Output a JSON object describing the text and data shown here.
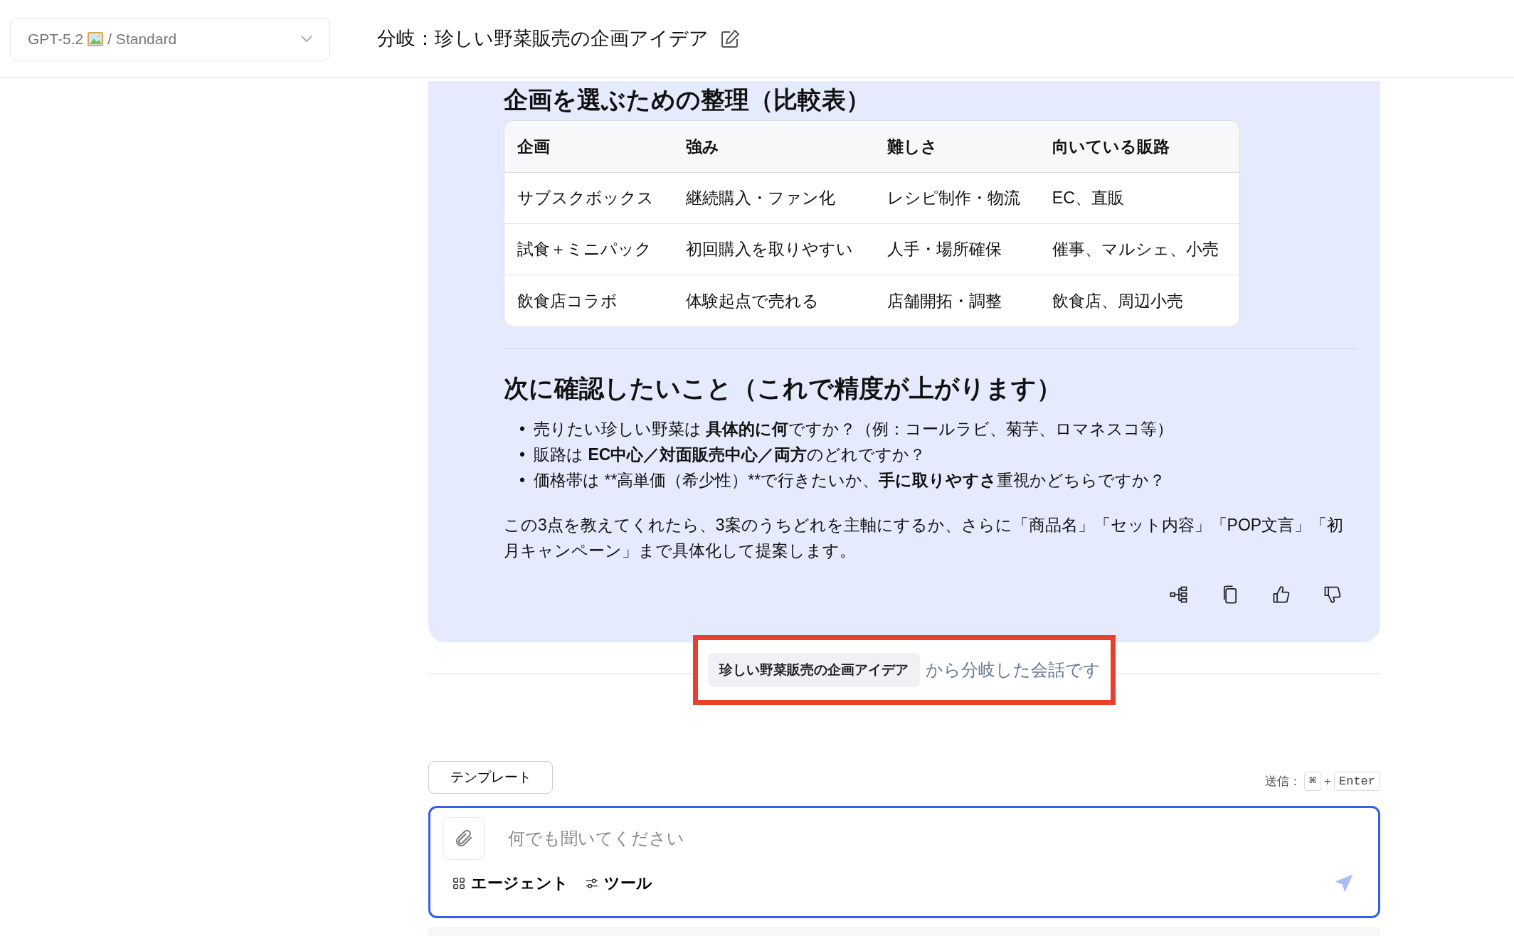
{
  "header": {
    "model_select": {
      "model": "GPT-5.2",
      "mode": "/ Standard"
    },
    "title": "分岐：珍しい野菜販売の企画アイデア"
  },
  "message": {
    "table_heading": "企画を選ぶための整理（比較表）",
    "table": {
      "columns": [
        "企画",
        "強み",
        "難しさ",
        "向いている販路"
      ],
      "rows": [
        [
          "サブスクボックス",
          "継続購入・ファン化",
          "レシピ制作・物流",
          "EC、直販"
        ],
        [
          "試食＋ミニパック",
          "初回購入を取りやすい",
          "人手・場所確保",
          "催事、マルシェ、小売"
        ],
        [
          "飲食店コラボ",
          "体験起点で売れる",
          "店舗開拓・調整",
          "飲食店、周辺小売"
        ]
      ]
    },
    "heading": "次に確認したいこと（これで精度が上がります）",
    "bullets": [
      {
        "marker": "•",
        "parts": [
          {
            "text": "売りたい珍しい野菜は ",
            "bold": false
          },
          {
            "text": "具体的に何",
            "bold": true
          },
          {
            "text": "ですか？（例：コールラビ、菊芋、ロマネスコ等）",
            "bold": false
          }
        ]
      },
      {
        "marker": "•",
        "parts": [
          {
            "text": "販路は ",
            "bold": false
          },
          {
            "text": "EC中心／対面販売中心／両方",
            "bold": true
          },
          {
            "text": "のどれですか？",
            "bold": false
          }
        ]
      },
      {
        "marker": "•",
        "parts": [
          {
            "text": "価格帯は **高単価（希少性）**で行きたいか、",
            "bold": false
          },
          {
            "text": "手に取りやすさ",
            "bold": true
          },
          {
            "text": "重視かどちらですか？",
            "bold": false
          }
        ]
      }
    ],
    "paragraph": "この3点を教えてくれたら、3案のうちどれを主軸にするか、さらに「商品名」「セット内容」「POP文言」「初月キャンペーン」まで具体化して提案します。",
    "actions": [
      {
        "kind": "branch"
      },
      {
        "kind": "copy"
      },
      {
        "kind": "like"
      },
      {
        "kind": "dislike"
      }
    ]
  },
  "branch_note": {
    "source": "珍しい野菜販売の企画アイデア",
    "text": "から分岐した会話です",
    "highlighted": true
  },
  "composer": {
    "template_button": "テンプレート",
    "send_hint": {
      "label": "送信：",
      "keys": [
        {
          "kind": "key",
          "text": "⌘"
        },
        {
          "kind": "plus",
          "text": "+"
        },
        {
          "kind": "key",
          "text": "Enter"
        }
      ]
    },
    "placeholder": "何でも聞いてください",
    "tools": [
      {
        "kind": "agent",
        "label": "エージェント"
      },
      {
        "kind": "tools",
        "label": "ツール"
      }
    ]
  }
}
